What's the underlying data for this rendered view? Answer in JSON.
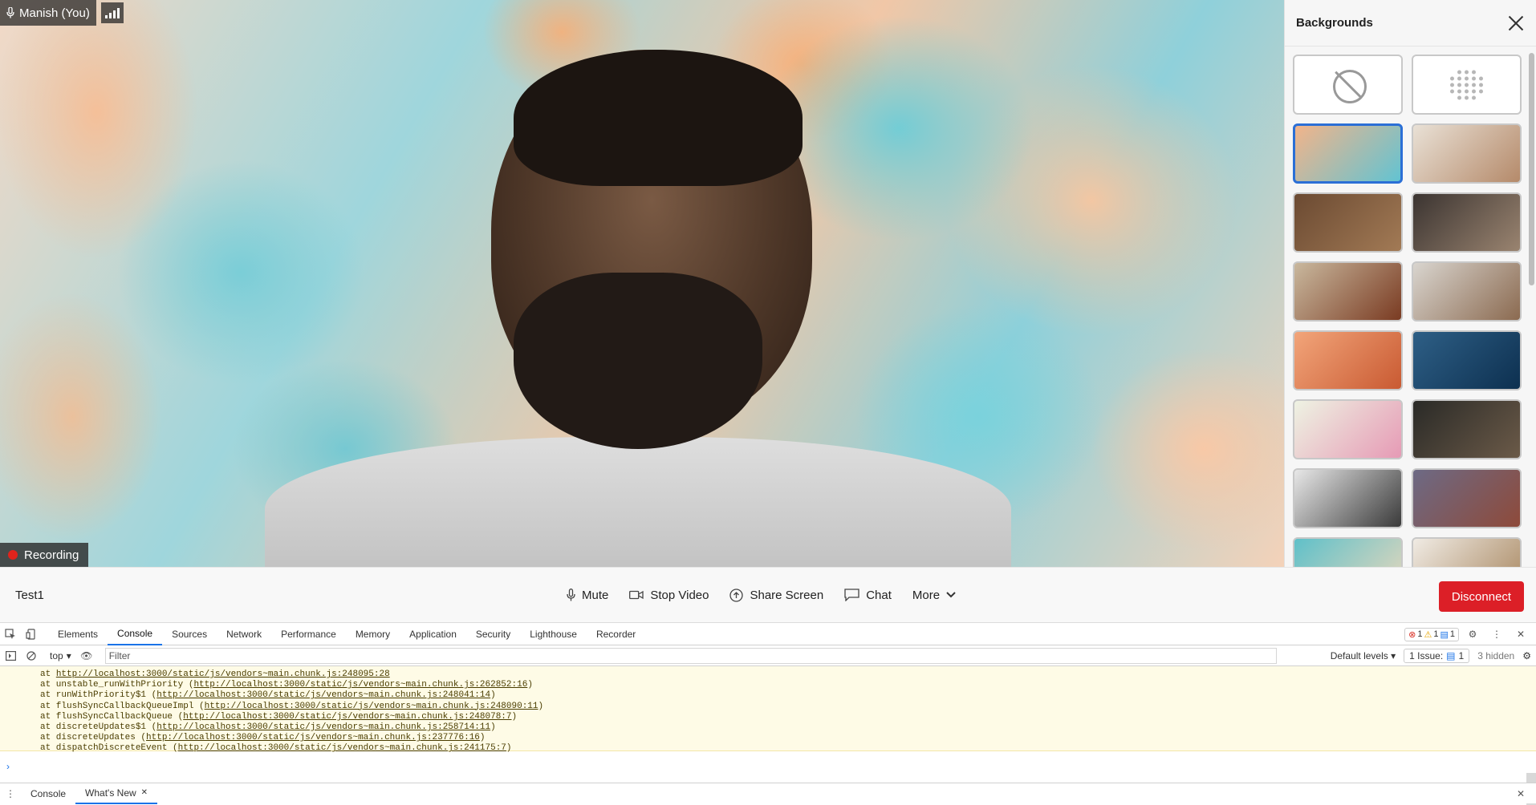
{
  "video": {
    "participant_name": "Manish (You)",
    "recording_label": "Recording"
  },
  "backgrounds_panel": {
    "title": "Backgrounds",
    "tiles": [
      {
        "kind": "none",
        "colors": [
          "#ffffff",
          "#ffffff"
        ]
      },
      {
        "kind": "blur",
        "colors": [
          "#ffffff",
          "#ffffff"
        ]
      },
      {
        "kind": "image",
        "colors": [
          "#f2b48a",
          "#62c3d2"
        ],
        "selected": true
      },
      {
        "kind": "image",
        "colors": [
          "#e9e1d6",
          "#b58a6a"
        ]
      },
      {
        "kind": "image",
        "colors": [
          "#6b4a32",
          "#a27a55"
        ]
      },
      {
        "kind": "image",
        "colors": [
          "#3b3431",
          "#9a8470"
        ]
      },
      {
        "kind": "image",
        "colors": [
          "#c9b89e",
          "#7a3b22"
        ]
      },
      {
        "kind": "image",
        "colors": [
          "#d9d5cf",
          "#8b6a50"
        ]
      },
      {
        "kind": "image",
        "colors": [
          "#f2a57a",
          "#c95a32"
        ]
      },
      {
        "kind": "image",
        "colors": [
          "#2e5f86",
          "#0d3050"
        ]
      },
      {
        "kind": "image",
        "colors": [
          "#eef3e3",
          "#e69ab5"
        ]
      },
      {
        "kind": "image",
        "colors": [
          "#2a2a27",
          "#6b5a48"
        ]
      },
      {
        "kind": "image",
        "colors": [
          "#e8e8e8",
          "#3a3a3a"
        ]
      },
      {
        "kind": "image",
        "colors": [
          "#6d6a85",
          "#8e4a3a"
        ]
      },
      {
        "kind": "image",
        "colors": [
          "#5fc0c9",
          "#e8d8bc"
        ]
      },
      {
        "kind": "image",
        "colors": [
          "#f0ebe4",
          "#a88760"
        ]
      }
    ]
  },
  "controls": {
    "meeting_name": "Test1",
    "mute": "Mute",
    "stop_video": "Stop Video",
    "share_screen": "Share Screen",
    "chat": "Chat",
    "more": "More",
    "disconnect": "Disconnect"
  },
  "devtools": {
    "tabs": [
      "Elements",
      "Console",
      "Sources",
      "Network",
      "Performance",
      "Memory",
      "Application",
      "Security",
      "Lighthouse",
      "Recorder"
    ],
    "active_tab": "Console",
    "error_count": "1",
    "warning_count": "1",
    "info_count": "1",
    "context": "top",
    "filter_placeholder": "Filter",
    "default_levels": "Default levels",
    "issues_label": "1 Issue:",
    "issues_count": "1",
    "hidden_label": "3 hidden",
    "stack_lines": [
      {
        "fn": "at ",
        "url": "http://localhost:3000/static/js/vendors~main.chunk.js:248095:28",
        "tail": ""
      },
      {
        "fn": "at unstable_runWithPriority (",
        "url": "http://localhost:3000/static/js/vendors~main.chunk.js:262852:16",
        "tail": ")"
      },
      {
        "fn": "at runWithPriority$1 (",
        "url": "http://localhost:3000/static/js/vendors~main.chunk.js:248041:14",
        "tail": ")"
      },
      {
        "fn": "at flushSyncCallbackQueueImpl (",
        "url": "http://localhost:3000/static/js/vendors~main.chunk.js:248090:11",
        "tail": ")"
      },
      {
        "fn": "at flushSyncCallbackQueue (",
        "url": "http://localhost:3000/static/js/vendors~main.chunk.js:248078:7",
        "tail": ")"
      },
      {
        "fn": "at discreteUpdates$1 (",
        "url": "http://localhost:3000/static/js/vendors~main.chunk.js:258714:11",
        "tail": ")"
      },
      {
        "fn": "at discreteUpdates (",
        "url": "http://localhost:3000/static/js/vendors~main.chunk.js:237776:16",
        "tail": ")"
      },
      {
        "fn": "at dispatchDiscreteEvent (",
        "url": "http://localhost:3000/static/js/vendors~main.chunk.js:241175:7",
        "tail": ")"
      }
    ],
    "drawer_tabs": [
      "Console",
      "What's New"
    ],
    "active_drawer_tab": "What's New"
  }
}
